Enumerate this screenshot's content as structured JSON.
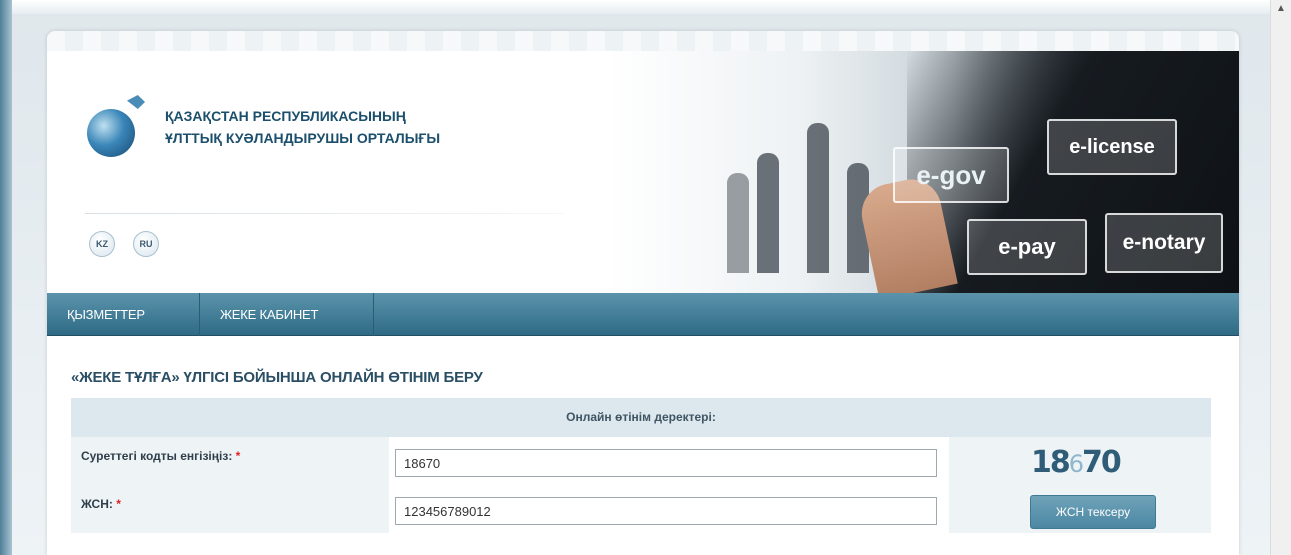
{
  "header": {
    "org_name_line1": "ҚАЗАҚСТАН РЕСПУБЛИКАСЫНЫҢ",
    "org_name_line2": "ҰЛТТЫҚ КУӘЛАНДЫРУШЫ ОРТАЛЫҒЫ",
    "languages": [
      "KZ",
      "RU"
    ],
    "banner_tiles": [
      "e-gov",
      "e-license",
      "e-pay",
      "e-notary"
    ]
  },
  "nav": {
    "items": [
      "ҚЫЗМЕТТЕР",
      "ЖЕКЕ КАБИНЕТ"
    ]
  },
  "page": {
    "title": "«ЖЕКЕ ТҰЛҒА» ҮЛГІСІ БОЙЫНША ОНЛАЙН ӨТІНІМ БЕРУ"
  },
  "form": {
    "header": "Онлайн өтінім деректері:",
    "captcha_label": "Суреттегі кодты енгізіңіз:",
    "captcha_value": "18670",
    "captcha_image_part1": "18",
    "captcha_image_part2": "6",
    "captcha_image_part3": "70",
    "iin_label": "ЖСН:",
    "iin_value": "123456789012",
    "required_mark": "*",
    "check_button": "ЖСН тексеру"
  },
  "colors": {
    "nav_bg": "#3f7e99",
    "title": "#2a4e64",
    "required": "#e02020",
    "button": "#5b93ad"
  },
  "icons": [
    "globe-logo-icon",
    "scroll-up-icon"
  ]
}
